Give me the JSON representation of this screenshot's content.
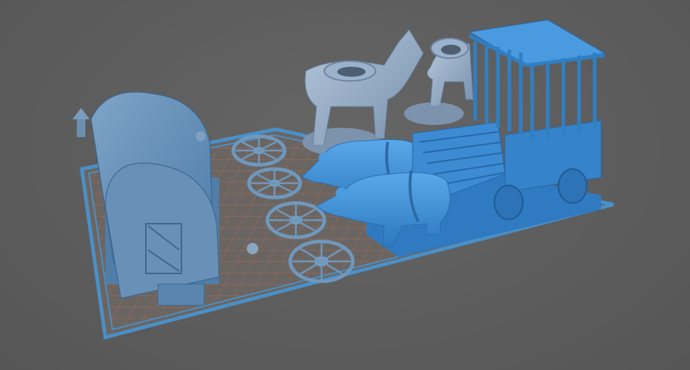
{
  "viewport": {
    "background_color": "#5f5f5f"
  },
  "build_plate": {
    "grid_color": "#c46f52",
    "border_color": "#4a90c8",
    "background_color": "#6b6562"
  },
  "models": [
    {
      "name": "covered-wagon",
      "color": "#5b8cb8"
    },
    {
      "name": "wagon-wheels",
      "color": "#6f98bd",
      "count": 4
    },
    {
      "name": "horse-left",
      "color": "#8ea7c4"
    },
    {
      "name": "horse-right",
      "color": "#8ea7c4"
    },
    {
      "name": "bear-back",
      "color": "#3e8fd6"
    },
    {
      "name": "bear-front",
      "color": "#3e8fd6"
    },
    {
      "name": "cage-wagon",
      "color": "#3a86c8"
    }
  ]
}
